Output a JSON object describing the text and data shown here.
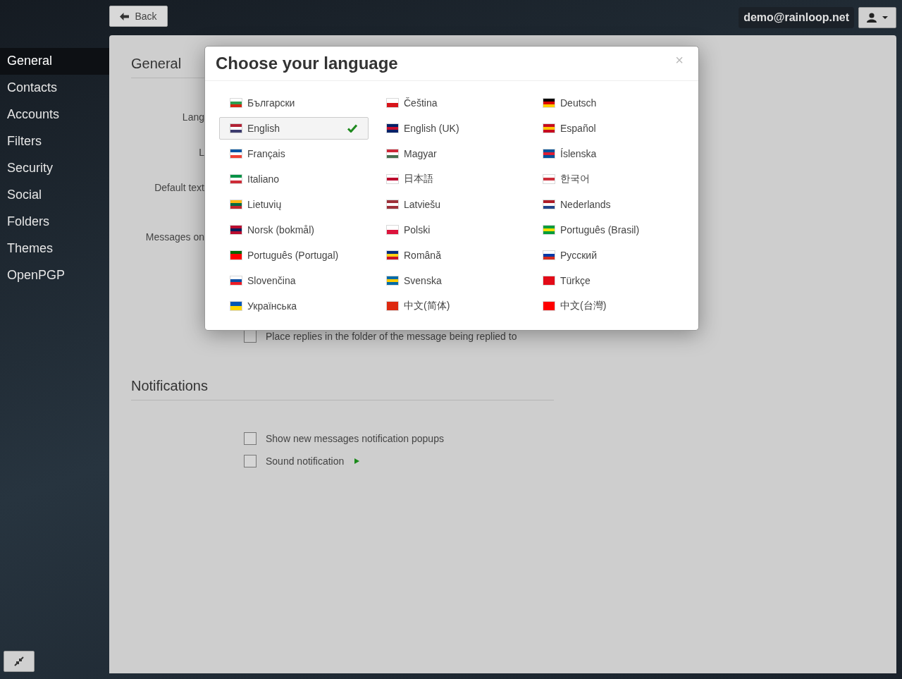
{
  "top_bar": {
    "back_button": "Back",
    "account": "demo@rainloop.net"
  },
  "sidebar": {
    "items": [
      {
        "label": "General",
        "selected": true
      },
      {
        "label": "Contacts",
        "selected": false
      },
      {
        "label": "Accounts",
        "selected": false
      },
      {
        "label": "Filters",
        "selected": false
      },
      {
        "label": "Security",
        "selected": false
      },
      {
        "label": "Social",
        "selected": false
      },
      {
        "label": "Folders",
        "selected": false
      },
      {
        "label": "Themes",
        "selected": false
      },
      {
        "label": "OpenPGP",
        "selected": false
      }
    ]
  },
  "general": {
    "heading": "General",
    "labels": [
      "Lang",
      "L",
      "Default text",
      "Messages on"
    ],
    "options": [
      {
        "label": "Place replies in the folder of the message being replied to",
        "checked": false
      }
    ]
  },
  "notifications": {
    "heading": "Notifications",
    "options": [
      {
        "label": "Show new messages notification popups",
        "checked": false,
        "play": false
      },
      {
        "label": "Sound notification",
        "checked": false,
        "play": true
      }
    ]
  },
  "dialog": {
    "title": "Choose your language",
    "close": "×",
    "languages": [
      {
        "label": "Български",
        "selected": false
      },
      {
        "label": "Čeština",
        "selected": false
      },
      {
        "label": "Deutsch",
        "selected": false
      },
      {
        "label": "English",
        "selected": true
      },
      {
        "label": "English (UK)",
        "selected": false
      },
      {
        "label": "Español",
        "selected": false
      },
      {
        "label": "Français",
        "selected": false
      },
      {
        "label": "Magyar",
        "selected": false
      },
      {
        "label": "Íslenska",
        "selected": false
      },
      {
        "label": "Italiano",
        "selected": false
      },
      {
        "label": "日本語",
        "selected": false
      },
      {
        "label": "한국어",
        "selected": false
      },
      {
        "label": "Lietuvių",
        "selected": false
      },
      {
        "label": "Latviešu",
        "selected": false
      },
      {
        "label": "Nederlands",
        "selected": false
      },
      {
        "label": "Norsk (bokmål)",
        "selected": false
      },
      {
        "label": "Polski",
        "selected": false
      },
      {
        "label": "Português (Brasil)",
        "selected": false
      },
      {
        "label": "Português (Portugal)",
        "selected": false
      },
      {
        "label": "Română",
        "selected": false
      },
      {
        "label": "Русский",
        "selected": false
      },
      {
        "label": "Slovenčina",
        "selected": false
      },
      {
        "label": "Svenska",
        "selected": false
      },
      {
        "label": "Türkçe",
        "selected": false
      },
      {
        "label": "Українська",
        "selected": false
      },
      {
        "label": "中文(简体)",
        "selected": false
      },
      {
        "label": "中文(台灣)",
        "selected": false
      }
    ]
  }
}
